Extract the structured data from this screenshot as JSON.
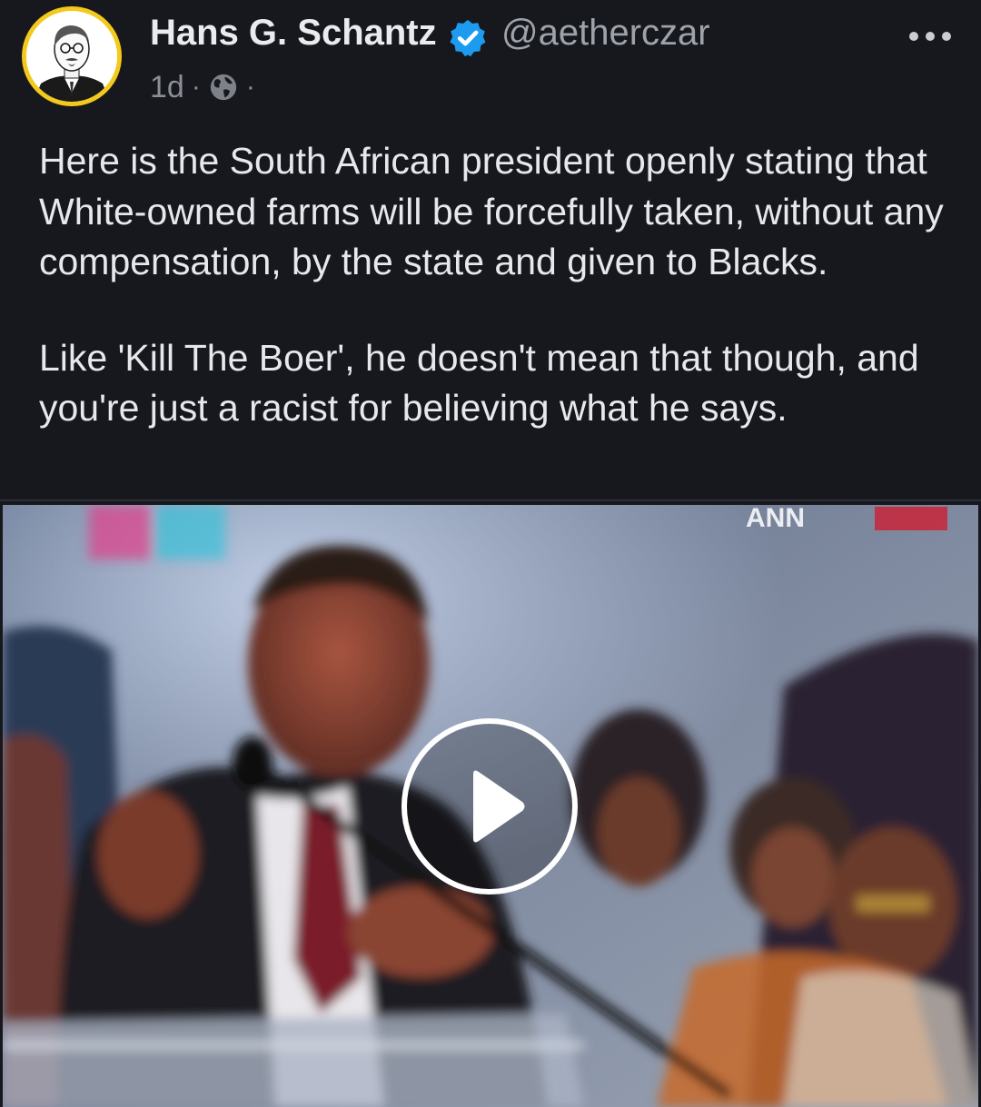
{
  "author": {
    "display_name": "Hans G. Schantz",
    "handle": "@aetherczar",
    "verified": true,
    "avatar_icon": "avatar-portrait-sketch"
  },
  "meta": {
    "timestamp": "1d",
    "separator": "·",
    "visibility_icon": "globe-icon"
  },
  "post": {
    "paragraphs": [
      "Here is the South African president openly stating that White-owned farms will be forcefully taken, without any compensation, by the state and given to Blacks.",
      "Like 'Kill The Boer', he doesn't mean that though, and you're just a racist for believing what he says."
    ]
  },
  "media": {
    "type": "video",
    "play_icon": "play-icon",
    "watermark_text": "ANN"
  },
  "colors": {
    "background": "#16181d",
    "text": "#e6e8eb",
    "muted": "#8a8f97",
    "verified": "#1d9bf0",
    "avatar_ring": "#f4c91a"
  }
}
